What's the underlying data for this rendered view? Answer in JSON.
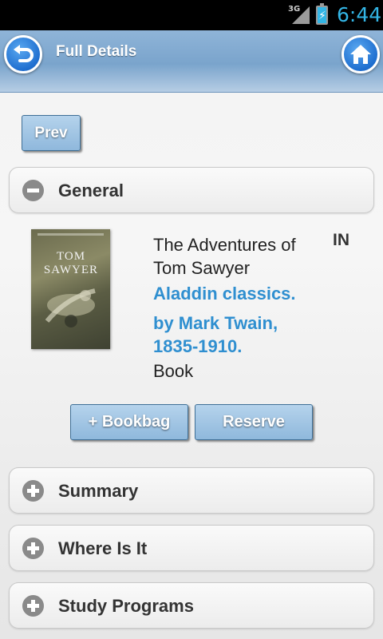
{
  "status_bar": {
    "network": "3G",
    "time": "6:44",
    "icons": [
      "signal-icon",
      "battery-charging-icon"
    ]
  },
  "header": {
    "title": "Full Details",
    "back_icon": "back-arrow-icon",
    "home_icon": "home-icon"
  },
  "nav": {
    "prev_label": "Prev"
  },
  "sections": [
    {
      "label": "General",
      "state": "expanded",
      "icon": "minus-circle-icon"
    },
    {
      "label": "Summary",
      "state": "collapsed",
      "icon": "plus-circle-icon"
    },
    {
      "label": "Where Is It",
      "state": "collapsed",
      "icon": "plus-circle-icon"
    },
    {
      "label": "Study Programs",
      "state": "collapsed",
      "icon": "plus-circle-icon"
    }
  ],
  "book": {
    "cover_text": "TOM SAWYER",
    "title": "The Adventures of Tom Sawyer",
    "publisher": "Aladdin classics.",
    "author": "by Mark Twain, 1835-1910.",
    "format": "Book",
    "status": "IN"
  },
  "actions": {
    "bookbag_label": "+ Bookbag",
    "reserve_label": "Reserve"
  },
  "colors": {
    "link": "#2f8fd0",
    "header": "#7aa4cc",
    "button": "#a3c7e6"
  }
}
